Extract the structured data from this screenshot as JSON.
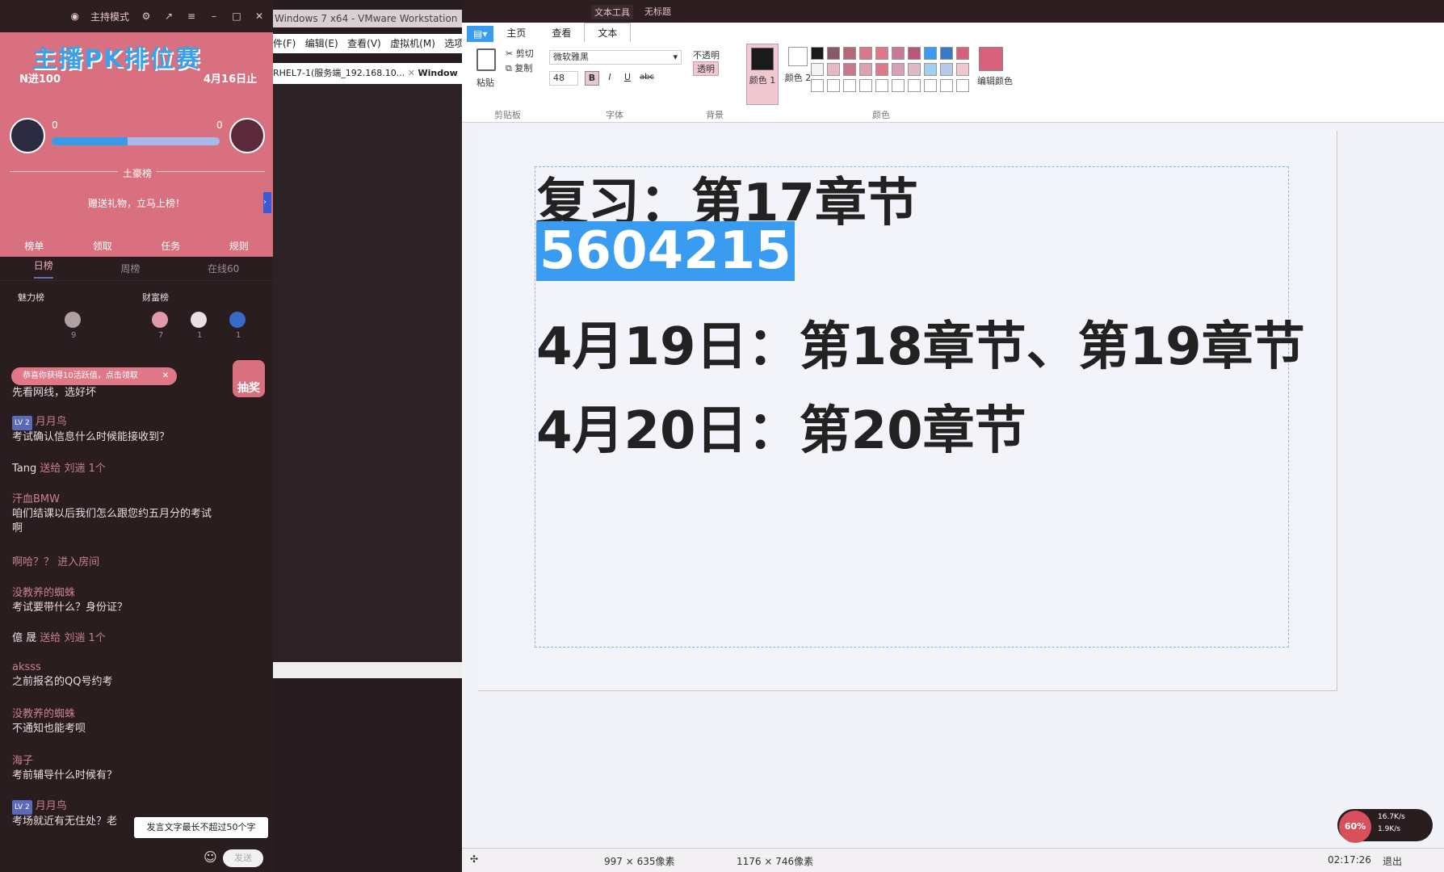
{
  "left_panel": {
    "mode_label": "主持模式",
    "banner_title": "主播PK排位赛",
    "banner_n": "N进100",
    "banner_date": "4月16日止",
    "pk_left_score": "0",
    "pk_right_score": "0",
    "pk_progress": 0.45,
    "rank_label": "土豪榜",
    "gift_prompt": "赠送礼物，立马上榜！",
    "footer": [
      "榜单",
      "领取",
      "任务",
      "规则"
    ],
    "tabs": [
      "日榜",
      "周榜",
      "在线60"
    ],
    "charm_label": "魅力榜",
    "wealth_label": "财富榜",
    "charm_count": "9",
    "wealth_counts": [
      "7",
      "1",
      "1"
    ],
    "notice": "恭喜你获得10活跃值，点击领取",
    "lottery": "抽奖",
    "chat": [
      {
        "user": "",
        "text": "先看网线，选好坏"
      },
      {
        "user": "月月鸟",
        "lv": "LV 2",
        "text": "考试确认信息什么时候能接收到？"
      },
      {
        "user": "Tang",
        "gift": "送给 刘遄 1个",
        "text": ""
      },
      {
        "user": "汗血BMW",
        "text": "咱们结课以后我们怎么跟您约五月分的考试"
      },
      {
        "user": "",
        "text": "啊"
      },
      {
        "user": "啊哈？？",
        "enter": "进入房间",
        "text": ""
      },
      {
        "user": "没教养的蜘蛛",
        "text": "考试要带什么？身份证？"
      },
      {
        "user": "億 晟",
        "gift": "送给 刘遄 1个",
        "text": ""
      },
      {
        "user": "aksss",
        "text": "之前报名的QQ号约考"
      },
      {
        "user": "没教养的蜘蛛",
        "text": "不通知也能考呗"
      },
      {
        "user": "海子",
        "text": "考前辅导什么时候有？"
      },
      {
        "user": "月月鸟",
        "lv": "LV 2",
        "text": "考场就近有无住处？老"
      }
    ],
    "tooltip": "发言文字最长不超过50个字",
    "send": "发送"
  },
  "vmware": {
    "title": "Windows 7 x64 - VMware Workstation",
    "menu": [
      "件(F)",
      "编辑(E)",
      "查看(V)",
      "虚拟机(M)",
      "选项"
    ],
    "tabs": [
      "RHEL7-1(服务端_192.168.10...",
      "Window"
    ]
  },
  "paint": {
    "title_tabs": [
      "文本工具",
      "无标题"
    ],
    "ribbon_tabs": [
      "主页",
      "查看",
      "文本"
    ],
    "paste": "粘贴",
    "cut": "剪切",
    "copy": "复制",
    "clipboard_group": "剪贴板",
    "font_name": "微软雅黑",
    "font_size": "48",
    "font_group": "字体",
    "opaque": "不透明",
    "transparent": "透明",
    "background_group": "背景",
    "color1": "颜色 1",
    "color2": "颜色 2",
    "edit_colors": "编辑颜色",
    "colors_group": "颜色",
    "lines": [
      "复习：第17章节",
      "5604215",
      "4月19日：第18章节、第19章节",
      "4月20日：第20章节"
    ],
    "status_sel": "997 × 635像素",
    "status_size": "1176 × 746像素",
    "net_pct": "60%",
    "net_up": "16.7K/s",
    "net_down": "1.9K/s",
    "clock": "02:17:26",
    "exit": "退出"
  },
  "colors": {
    "accent": "#3a9cf0",
    "banner": "#d9707f",
    "palette": [
      "#1a1a1a",
      "#8a5a6a",
      "#b86878",
      "#d87888",
      "#e07888",
      "#c87898",
      "#b85878",
      "#3a9cf0",
      "#3a7ac8",
      "#d8607a",
      "#f4f4f4",
      "#e8b8c0",
      "#c87888",
      "#e0a0b0",
      "#e07888",
      "#d8a0b8",
      "#e0b8c8",
      "#a0d0f0",
      "#b8c8e8",
      "#f0c8d0"
    ]
  }
}
